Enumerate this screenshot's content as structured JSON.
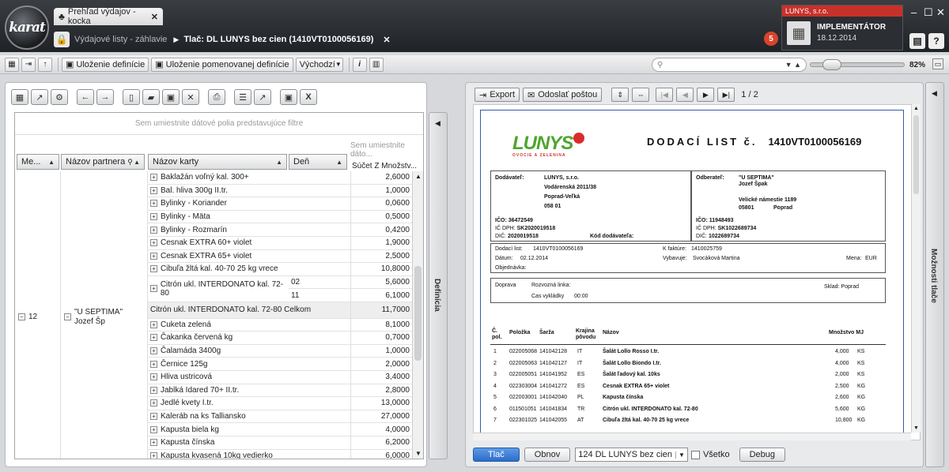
{
  "app": {
    "logo_text": "karat",
    "tab_title": "Prehľad výdajov - kocka",
    "breadcrumb_1": "Výdajové listy - záhlavie",
    "breadcrumb_2": "Tlač: DL LUNYS bez cien (1410VT0100056169)",
    "notification_count": "5",
    "company_name": "LUNYS, s.r.o.",
    "role": "IMPLEMENTÁTOR",
    "date": "18.12.2014",
    "accent_color": "#c8312a"
  },
  "toolbar": {
    "save_definition": "Uloženie definície",
    "save_named_definition": "Uloženie pomenovanej definície",
    "default_select": "Východzí",
    "search_placeholder": "",
    "zoom": "82%"
  },
  "pivot": {
    "filter_hint": "Sem umiestnite dátové polia predstavujúce filtre",
    "data_hint": "Sem umiestnite dáto...",
    "headers": {
      "me": "Me...",
      "partner": "Názov partnera",
      "card": "Názov karty",
      "den": "Deň",
      "sum": "Súčet Z Množstv..."
    },
    "month": "12",
    "partner": "\"U SEPTIMA\"",
    "partner2": "Jozef Šp",
    "rows": [
      {
        "card": "Baklažán voľný kal. 300+",
        "value": "2,6000"
      },
      {
        "card": "Bal. hliva 300g II.tr.",
        "value": "1,0000"
      },
      {
        "card": "Bylinky - Koriander",
        "value": "0,0600"
      },
      {
        "card": "Bylinky - Mäta",
        "value": "0,5000"
      },
      {
        "card": "Bylinky - Rozmarín",
        "value": "0,4200"
      },
      {
        "card": "Cesnak EXTRA 60+ violet",
        "value": "1,9000"
      },
      {
        "card": "Cesnak EXTRA 65+ violet",
        "value": "2,5000"
      },
      {
        "card": "Cibuľa žltá kal. 40-70 25 kg vrece",
        "value": "10,8000"
      }
    ],
    "citron_card": "Citrón ukl. INTERDONATO kal. 72-80",
    "citron_den1": "02",
    "citron_val1": "5,6000",
    "citron_den2": "11",
    "citron_val2": "6,1000",
    "citron_total_label": "Citrón ukl. INTERDONATO kal. 72-80 Celkom",
    "citron_total": "11,7000",
    "rows2": [
      {
        "card": "Cuketa zelená",
        "value": "8,1000"
      },
      {
        "card": "Čakanka červená kg",
        "value": "0,7000"
      },
      {
        "card": "Čalamáda 3400g",
        "value": "1,0000"
      },
      {
        "card": "Černice 125g",
        "value": "2,0000"
      },
      {
        "card": "Hliva ustricová",
        "value": "3,4000"
      },
      {
        "card": "Jablká Idared 70+ II.tr.",
        "value": "2,8000"
      },
      {
        "card": "Jedlé kvety I.tr.",
        "value": "13,0000"
      },
      {
        "card": "Kaleráb na ks Talliansko",
        "value": "27,0000"
      },
      {
        "card": "Kapusta biela kg",
        "value": "4,0000"
      },
      {
        "card": "Kapusta čínska",
        "value": "6,2000"
      },
      {
        "card": "Kapusta kvasená 10kg vedierko",
        "value": "6,0000"
      }
    ],
    "side_tab": "Definícia"
  },
  "preview": {
    "export": "Export",
    "send_mail": "Odoslať poštou",
    "page_info": "1 / 2",
    "side_tab": "Možnosti tlače",
    "print": "Tlač",
    "refresh": "Obnov",
    "report_select": "124 DL LUNYS bez cien",
    "all_label": "Všetko",
    "debug": "Debug"
  },
  "document": {
    "logo": "LUNYS",
    "logo_sub": "OVOCIE A ZELENINA",
    "title": "DODACÍ LIST č.",
    "number": "1410VT0100056169",
    "supplier_label": "Dodávateľ:",
    "supplier_name": "LUNYS, s.r.o.",
    "supplier_street": "Vodárenská 2011/38",
    "supplier_city": "Poprad-Veľká",
    "supplier_zip": "058 01",
    "ico_label": "IČO:",
    "supplier_ico": "36472549",
    "icdph_label": "IČ DPH:",
    "supplier_icdph": "SK2020019518",
    "dic_label": "DIČ:",
    "supplier_dic": "2020019518",
    "supplier_code_label": "Kód dodávateľa:",
    "customer_label": "Odberateľ:",
    "customer_name": "\"U SEPTIMA\"",
    "customer_person": "Jozef Špak",
    "customer_street": "Velické námestie 1189",
    "customer_zip": "05801",
    "customer_city": "Poprad",
    "customer_ico": "11948493",
    "customer_icdph": "SK1022689734",
    "customer_dic": "1022689734",
    "dl_label": "Dodací list:",
    "dl_value": "1410VT0100056169",
    "date_label": "Dátum:",
    "date_value": "02.12.2014",
    "order_label": "Objednávka:",
    "invoice_label": "K faktúre:",
    "invoice_value": "1410025759",
    "issued_label": "Vybavuje:",
    "issued_value": "Svocáková Martina",
    "currency_label": "Mena:",
    "currency_value": "EUR",
    "transport_label": "Doprava",
    "route_label": "Rozvozná linka:",
    "warehouse_label": "Sklad:",
    "warehouse_value": "Poprad",
    "unload_label": "Cas vykládky",
    "unload_value": "00:00",
    "cols": {
      "no": "Č.",
      "pol": "pol.",
      "item": "Položka",
      "batch": "Šarža",
      "country": "Krajina",
      "origin": "pôvodu",
      "name": "Názov",
      "qty": "Množstvo",
      "unit": "MJ"
    },
    "lines": [
      {
        "no": "1",
        "item": "022005068",
        "batch": "141042128",
        "country": "IT",
        "name": "Šalát Lollo Rosso I.tr.",
        "qty": "4,000",
        "unit": "KS"
      },
      {
        "no": "2",
        "item": "022005063",
        "batch": "141042127",
        "country": "IT",
        "name": "Šalát Lollo Biondo I.tr.",
        "qty": "4,000",
        "unit": "KS"
      },
      {
        "no": "3",
        "item": "022005051",
        "batch": "141041952",
        "country": "ES",
        "name": "Šalát ľadový kal. 10ks",
        "qty": "2,000",
        "unit": "KS"
      },
      {
        "no": "4",
        "item": "022303004",
        "batch": "141041272",
        "country": "ES",
        "name": "Cesnak EXTRA 65+ violet",
        "qty": "2,500",
        "unit": "KG"
      },
      {
        "no": "5",
        "item": "022003001",
        "batch": "141042040",
        "country": "PL",
        "name": "Kapusta čínska",
        "qty": "2,600",
        "unit": "KG"
      },
      {
        "no": "6",
        "item": "011501051",
        "batch": "141041834",
        "country": "TR",
        "name": "Citrón ukl. INTERDONATO kal. 72-80",
        "qty": "5,600",
        "unit": "KG"
      },
      {
        "no": "7",
        "item": "022301025",
        "batch": "141042055",
        "country": "AT",
        "name": "Cibuľa žltá kal. 40-70 25 kg vrece",
        "qty": "10,800",
        "unit": "KG"
      }
    ]
  }
}
